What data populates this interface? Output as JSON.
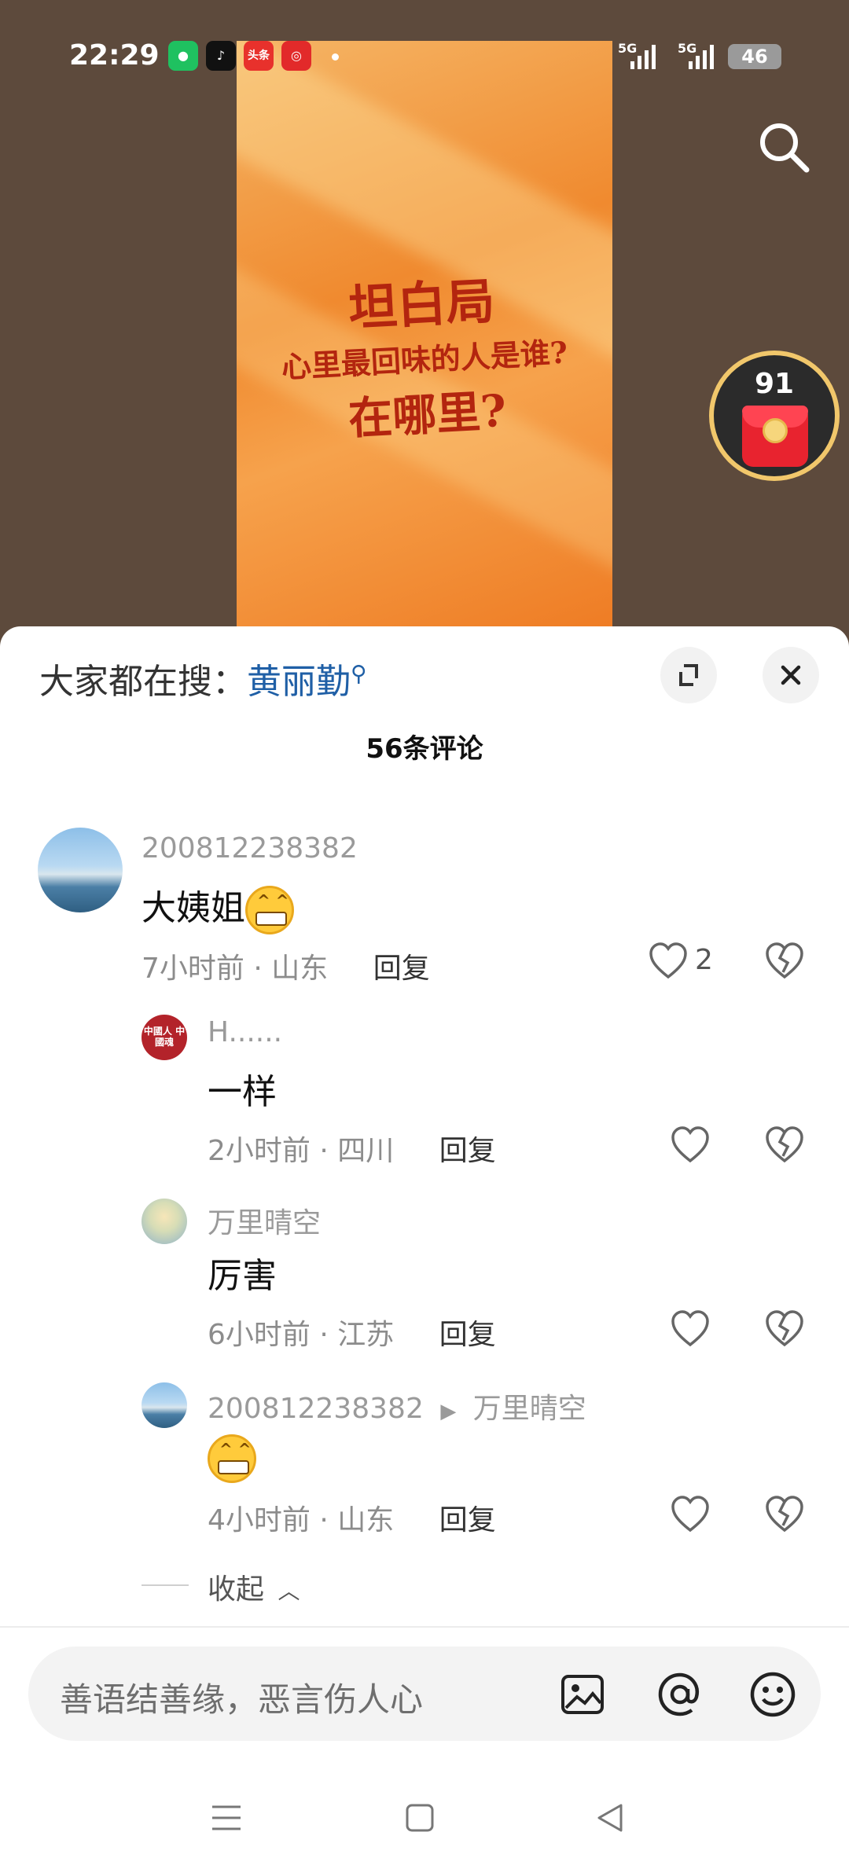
{
  "status_bar": {
    "time": "22:29",
    "apps": [
      "wechat-icon",
      "douyin-icon",
      "toutiao-icon",
      "pinduoduo-icon"
    ],
    "toutiao_label": "头条",
    "signal1": "5G",
    "signal2": "5G",
    "battery": "46"
  },
  "video": {
    "poster_line1": "坦白局",
    "poster_line2": "心里最回味的人是谁?",
    "poster_line3": "在哪里?"
  },
  "redpack": {
    "count": "91"
  },
  "sheet": {
    "hot_label": "大家都在搜：",
    "hot_keyword": "黄丽勤",
    "title": "56条评论"
  },
  "comments": [
    {
      "user": "200812238382",
      "text": "大姨姐",
      "meta": "7小时前 · 山东",
      "reply": "回复",
      "likes": "2"
    },
    {
      "user": "H......",
      "text": "一样",
      "meta": "2小时前 · 四川",
      "reply": "回复",
      "avatar_text": "中國人 中國魂"
    },
    {
      "user": "万里晴空",
      "text": "厉害",
      "meta": "6小时前 · 江苏",
      "reply": "回复"
    },
    {
      "user": "200812238382",
      "reply_to": "万里晴空",
      "text": "",
      "meta": "4小时前 · 山东",
      "reply": "回复"
    }
  ],
  "collapse_label": "收起",
  "input": {
    "placeholder": "善语结善缘，恶言伤人心"
  },
  "colors": {
    "keyword": "#1f5fa6",
    "sheet_bg": "#ffffff",
    "video_bg": "#5d4a3c",
    "poster_text": "#b3250f"
  }
}
